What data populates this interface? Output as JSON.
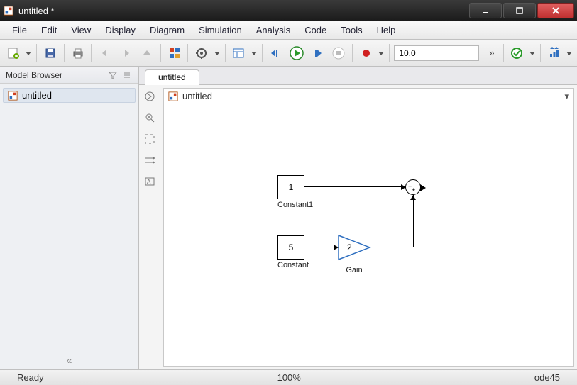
{
  "window": {
    "title": "untitled *"
  },
  "menubar": [
    "File",
    "Edit",
    "View",
    "Display",
    "Diagram",
    "Simulation",
    "Analysis",
    "Code",
    "Tools",
    "Help"
  ],
  "toolbar": {
    "stop_time": "10.0",
    "more_glyph": "»"
  },
  "sidebar": {
    "header": "Model Browser",
    "item": "untitled",
    "collapse_glyph": "«"
  },
  "tabs": {
    "active": "untitled"
  },
  "breadcrumb": {
    "path": "untitled",
    "dropdown_glyph": "▾"
  },
  "blocks": {
    "constant1": {
      "value": "1",
      "label": "Constant1"
    },
    "constant": {
      "value": "5",
      "label": "Constant"
    },
    "gain": {
      "value": "2",
      "label": "Gain"
    },
    "sum": {
      "label": ""
    }
  },
  "status": {
    "left": "Ready",
    "zoom": "100%",
    "solver": "ode45"
  }
}
